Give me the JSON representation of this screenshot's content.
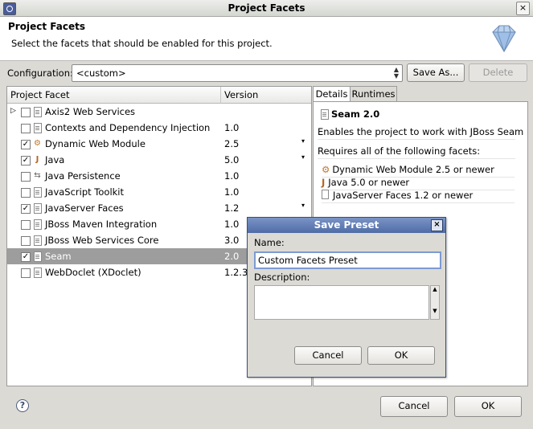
{
  "window": {
    "title": "Project Facets",
    "close": "×"
  },
  "header": {
    "title": "Project Facets",
    "subtitle": "Select the facets that should be enabled for this project."
  },
  "config": {
    "label": "Configuration:",
    "value": "<custom>",
    "save_as": "Save As...",
    "delete": "Delete"
  },
  "table": {
    "col_facet": "Project Facet",
    "col_version": "Version",
    "rows": [
      {
        "label": "Axis2 Web Services",
        "version": "",
        "checked": false
      },
      {
        "label": "Contexts and Dependency Injection",
        "version": "1.0",
        "checked": false
      },
      {
        "label": "Dynamic Web Module",
        "version": "2.5",
        "checked": true
      },
      {
        "label": "Java",
        "version": "5.0",
        "checked": true
      },
      {
        "label": "Java Persistence",
        "version": "1.0",
        "checked": false
      },
      {
        "label": "JavaScript Toolkit",
        "version": "1.0",
        "checked": false
      },
      {
        "label": "JavaServer Faces",
        "version": "1.2",
        "checked": true
      },
      {
        "label": "JBoss Maven Integration",
        "version": "1.0",
        "checked": false
      },
      {
        "label": "JBoss Web Services Core",
        "version": "3.0",
        "checked": false
      },
      {
        "label": "Seam",
        "version": "2.0",
        "checked": true
      },
      {
        "label": "WebDoclet (XDoclet)",
        "version": "1.2.3",
        "checked": false
      }
    ]
  },
  "details": {
    "tab_details": "Details",
    "tab_runtimes": "Runtimes",
    "facet_title": "Seam 2.0",
    "description": "Enables the project to work with JBoss Seam",
    "requires": "Requires all of the following facets:",
    "req": [
      "Dynamic Web Module 2.5 or newer",
      "Java 5.0 or newer",
      "JavaServer Faces 1.2 or newer"
    ]
  },
  "dialog": {
    "title": "Save Preset",
    "name_label": "Name:",
    "name_value": "Custom Facets Preset",
    "desc_label": "Description:",
    "cancel": "Cancel",
    "ok": "OK"
  },
  "footer": {
    "help": "?",
    "cancel": "Cancel",
    "ok": "OK"
  },
  "marks": {
    "check": "✓"
  }
}
